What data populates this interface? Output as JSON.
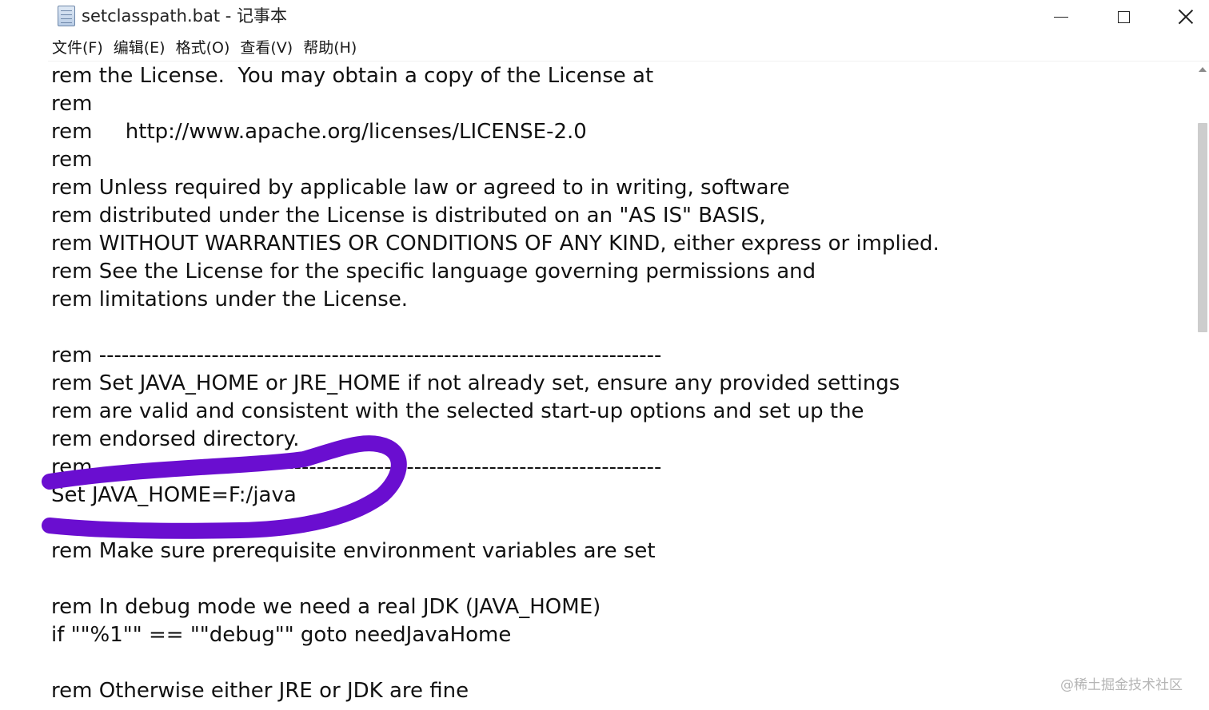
{
  "window": {
    "title": "setclasspath.bat - 记事本",
    "controls": {
      "minimize": "minimize",
      "maximize": "maximize",
      "close": "close"
    }
  },
  "menu": [
    {
      "label": "文件(F)"
    },
    {
      "label": "编辑(E)"
    },
    {
      "label": "格式(O)"
    },
    {
      "label": "查看(V)"
    },
    {
      "label": "帮助(H)"
    }
  ],
  "editor": {
    "lines": [
      "rem the License.  You may obtain a copy of the License at",
      "rem",
      "rem     http://www.apache.org/licenses/LICENSE-2.0",
      "rem",
      "rem Unless required by applicable law or agreed to in writing, software",
      "rem distributed under the License is distributed on an \"AS IS\" BASIS,",
      "rem WITHOUT WARRANTIES OR CONDITIONS OF ANY KIND, either express or implied.",
      "rem See the License for the specific language governing permissions and",
      "rem limitations under the License.",
      "",
      "rem ---------------------------------------------------------------------------",
      "rem Set JAVA_HOME or JRE_HOME if not already set, ensure any provided settings",
      "rem are valid and consistent with the selected start-up options and set up the",
      "rem endorsed directory.",
      "rem ---------------------------------------------------------------------------",
      "Set JAVA_HOME=F:/java",
      "",
      "rem Make sure prerequisite environment variables are set",
      "",
      "rem In debug mode we need a real JDK (JAVA_HOME)",
      "if \"\"%1\"\" == \"\"debug\"\" goto needJavaHome",
      "",
      "rem Otherwise either JRE or JDK are fine"
    ]
  },
  "annotation": {
    "color": "#6a0ed0"
  },
  "watermark": "@稀土掘金技术社区"
}
